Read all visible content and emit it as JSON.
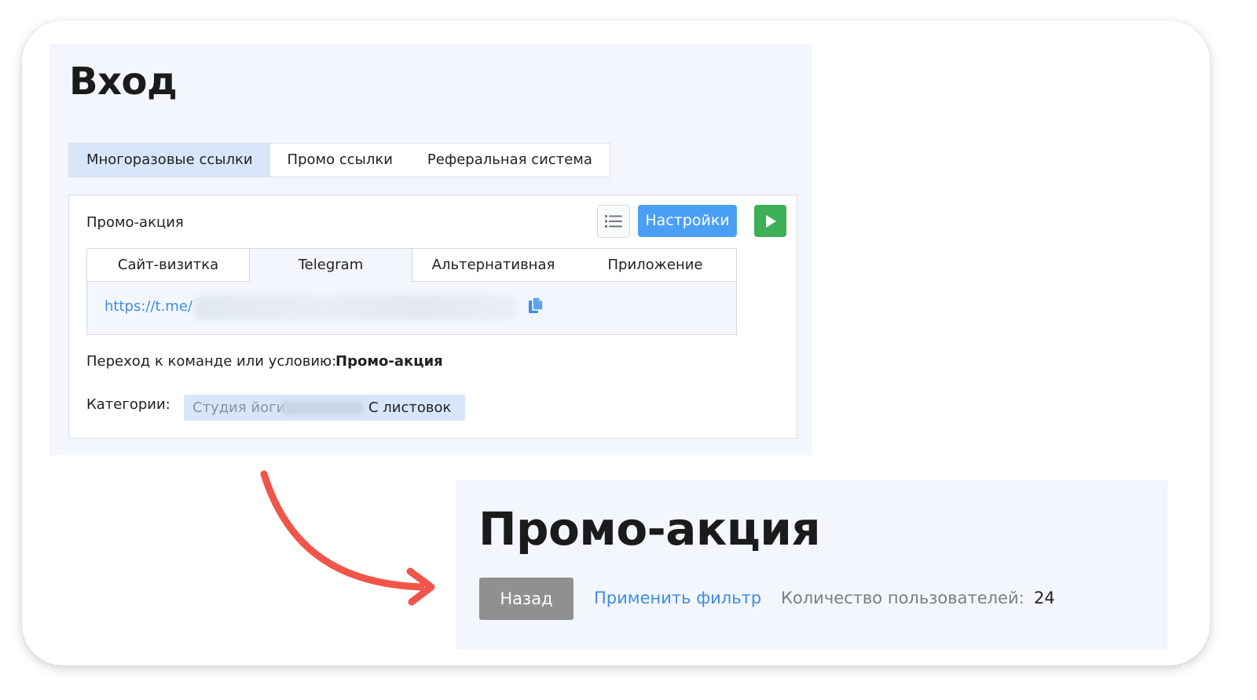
{
  "top": {
    "title": "Вход",
    "tabs": [
      {
        "label": "Многоразовые ссылки",
        "active": true
      },
      {
        "label": "Промо ссылки",
        "active": false
      },
      {
        "label": "Реферальная система",
        "active": false
      }
    ],
    "card": {
      "title": "Промо-акция",
      "settings_label": "Настройки",
      "list_icon": "list-icon",
      "play_icon": "play-icon",
      "sub_tabs": [
        {
          "label": "Сайт-визитка",
          "active": false
        },
        {
          "label": "Telegram",
          "active": true
        },
        {
          "label": "Альтернативная",
          "active": false
        },
        {
          "label": "Приложение",
          "active": false
        }
      ],
      "link": "https://t.me/",
      "copy_icon": "copy-icon",
      "goto_label": "Переход к команде или условию:",
      "goto_value": "Промо-акция",
      "categories_label": "Категории:",
      "categories": [
        "Студия йоги",
        "С листовок"
      ]
    }
  },
  "bottom": {
    "title": "Промо-акция",
    "back_label": "Назад",
    "filter_label": "Применить фильтр",
    "users_label": "Количество пользователей:",
    "users_count": "24"
  },
  "colors": {
    "accent_blue": "#4a9ff5",
    "link_blue": "#3d8ee6",
    "play_green": "#3daf57",
    "arrow_red": "#f0554a",
    "panel_bg": "#f3f6fc"
  }
}
